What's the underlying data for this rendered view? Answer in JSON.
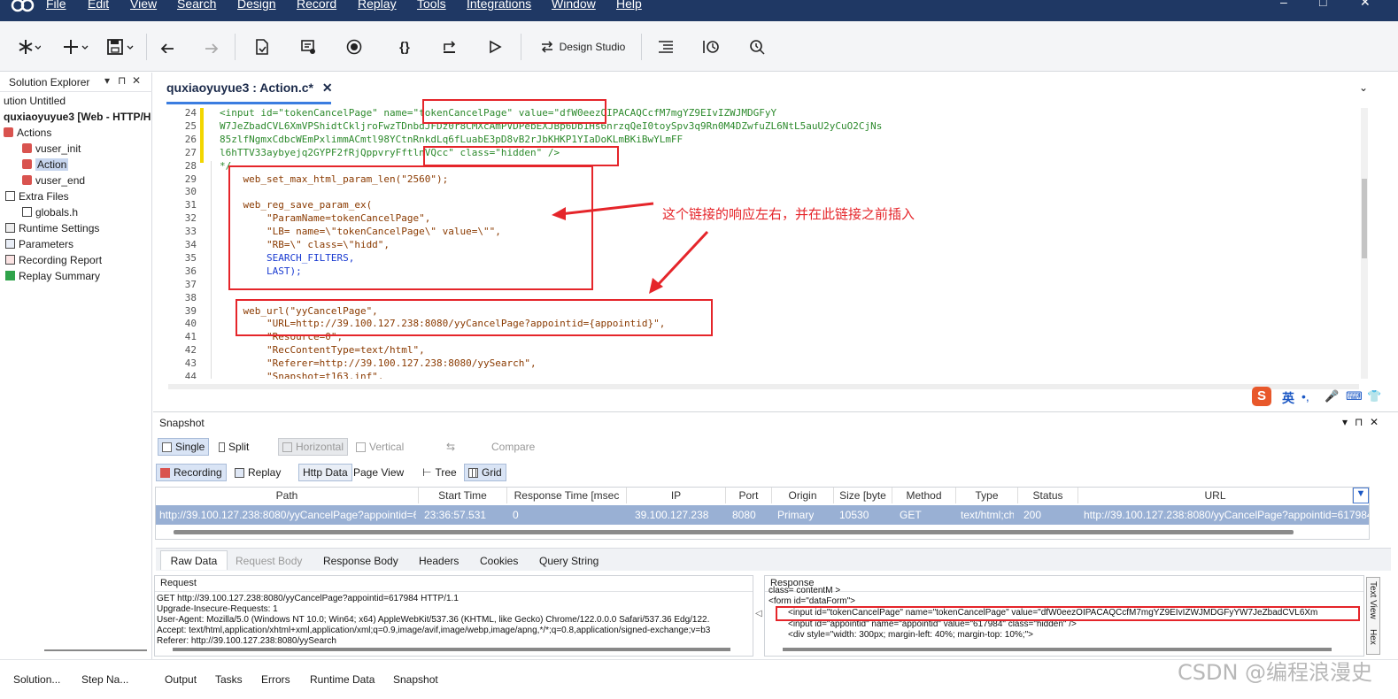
{
  "menu": [
    "File",
    "Edit",
    "View",
    "Search",
    "Design",
    "Record",
    "Replay",
    "Tools",
    "Integrations",
    "Window",
    "Help"
  ],
  "window_controls": [
    "–",
    "□",
    "✕"
  ],
  "toolbar": {
    "design_studio": "Design Studio"
  },
  "solution": {
    "title": "Solution Explorer",
    "pin_icons": [
      "▾",
      "⊓",
      "✕"
    ],
    "items": [
      "ution Untitled",
      "quxiaoyuyue3 [Web - HTTP/HT",
      "Actions",
      "vuser_init",
      "Action",
      "vuser_end",
      "Extra Files",
      "globals.h",
      "Runtime Settings",
      "Parameters",
      "Recording Report",
      "Replay Summary"
    ]
  },
  "editor": {
    "tab_title": "quxiaoyuyue3 : Action.c*",
    "tab_close": "✕",
    "lines": [
      {
        "n": "24",
        "t": "<input id=\"tokenCancelPage\" name=\"tokenCancelPage\" value=\"dfW0eezOIPACAQCcfM7mgYZ9EIvIZWJMDGFyY"
      },
      {
        "n": "25",
        "t": "W7JeZbadCVL6XmVPShidtCkljroFwzTDnbdJFDz0r8CMXcAmPVDPebEXJBp6Db1Hs6nrzqQeI0toySpv3q9Rn0M4DZwfuZL6NtL5auU2yCuO2CjNs"
      },
      {
        "n": "26",
        "t": "85zlfNgmxCdbcWEmPxlimmACmtl98YCtnRnkdLq6fLuabE3pD8vB2rJbKHKP1YIaDoKLmBKiBwYLmFF"
      },
      {
        "n": "27",
        "t": "l6hTTV33aybyejq2GYPF2fRjQppvryFftlnVQcc\" class=\"hidden\" />"
      },
      {
        "n": "28",
        "t": "*/"
      },
      {
        "n": "29",
        "t": "    web_set_max_html_param_len(\"2560\");"
      },
      {
        "n": "30",
        "t": ""
      },
      {
        "n": "31",
        "t": "    web_reg_save_param_ex("
      },
      {
        "n": "32",
        "t": "        \"ParamName=tokenCancelPage\","
      },
      {
        "n": "33",
        "t": "        \"LB= name=\\\"tokenCancelPage\\\" value=\\\"\","
      },
      {
        "n": "34",
        "t": "        \"RB=\\\" class=\\\"hidd\","
      },
      {
        "n": "35",
        "t": "        SEARCH_FILTERS,"
      },
      {
        "n": "36",
        "t": "        LAST);"
      },
      {
        "n": "37",
        "t": ""
      },
      {
        "n": "38",
        "t": ""
      },
      {
        "n": "39",
        "t": "    web_url(\"yyCancelPage\","
      },
      {
        "n": "40",
        "t": "        \"URL=http://39.100.127.238:8080/yyCancelPage?appointid={appointid}\","
      },
      {
        "n": "41",
        "t": "        \"Resource=0\","
      },
      {
        "n": "42",
        "t": "        \"RecContentType=text/html\","
      },
      {
        "n": "43",
        "t": "        \"Referer=http://39.100.127.238:8080/yySearch\","
      },
      {
        "n": "44",
        "t": "        \"Snapshot=t163.inf\","
      }
    ],
    "annotation": "这个链接的响应左右，并在此链接之前插入"
  },
  "snapshot": {
    "title": "Snapshot",
    "controls": [
      "▾",
      "⊓",
      "✕"
    ],
    "row1": [
      "Single",
      "Split",
      "Horizontal",
      "Vertical",
      "Compare"
    ],
    "row2": [
      "Recording",
      "Replay",
      "Http Data",
      "Page View",
      "Tree",
      "Grid"
    ],
    "columns": [
      "Path",
      "Start Time",
      "Response Time [msec",
      "IP",
      "Port",
      "Origin",
      "Size [byte",
      "Method",
      "Type",
      "Status",
      "URL"
    ],
    "row": [
      "http://39.100.127.238:8080/yyCancelPage?appointid=6",
      "23:36:57.531",
      "0",
      "39.100.127.238",
      "8080",
      "Primary",
      "10530",
      "GET",
      "text/html;ch",
      "200",
      "http://39.100.127.238:8080/yyCancelPage?appointid=617984"
    ],
    "detail_tabs": [
      "Raw Data",
      "Request Body",
      "Response Body",
      "Headers",
      "Cookies",
      "Query String"
    ],
    "request": {
      "title": "Request",
      "lines": [
        "GET http://39.100.127.238:8080/yyCancelPage?appointid=617984 HTTP/1.1",
        "Upgrade-Insecure-Requests: 1",
        "User-Agent: Mozilla/5.0 (Windows NT 10.0; Win64; x64) AppleWebKit/537.36 (KHTML, like Gecko) Chrome/122.0.0.0 Safari/537.36 Edg/122.",
        "Accept: text/html,application/xhtml+xml,application/xml;q=0.9,image/avif,image/webp,image/apng,*/*;q=0.8,application/signed-exchange;v=b3",
        "Referer: http://39.100.127.238:8080/yySearch"
      ]
    },
    "response": {
      "title": "Response",
      "lines": [
        "class= contentM >",
        "<form id=\"dataForm\">",
        "<input id=\"tokenCancelPage\" name=\"tokenCancelPage\" value=\"dfW0eezOIPACAQCcfM7mgYZ9EIvIZWJMDGFyYW7JeZbadCVL6Xm",
        "<input id=\"appointid\" name=\"appointid\" value=\"617984\" class=\"hidden\" />",
        "<div style=\"width: 300px; margin-left: 40%; margin-top: 10%;\">"
      ]
    },
    "side_tabs": [
      "Text View",
      "Hex"
    ]
  },
  "bottom": {
    "left": [
      "Solution...",
      "Step Na..."
    ],
    "tabs": [
      "Output",
      "Tasks",
      "Errors",
      "Runtime Data",
      "Snapshot"
    ]
  },
  "ime": [
    "S",
    "英",
    "•,",
    "🎤",
    "⌨",
    "👕"
  ],
  "watermark": "CSDN @编程浪漫史"
}
